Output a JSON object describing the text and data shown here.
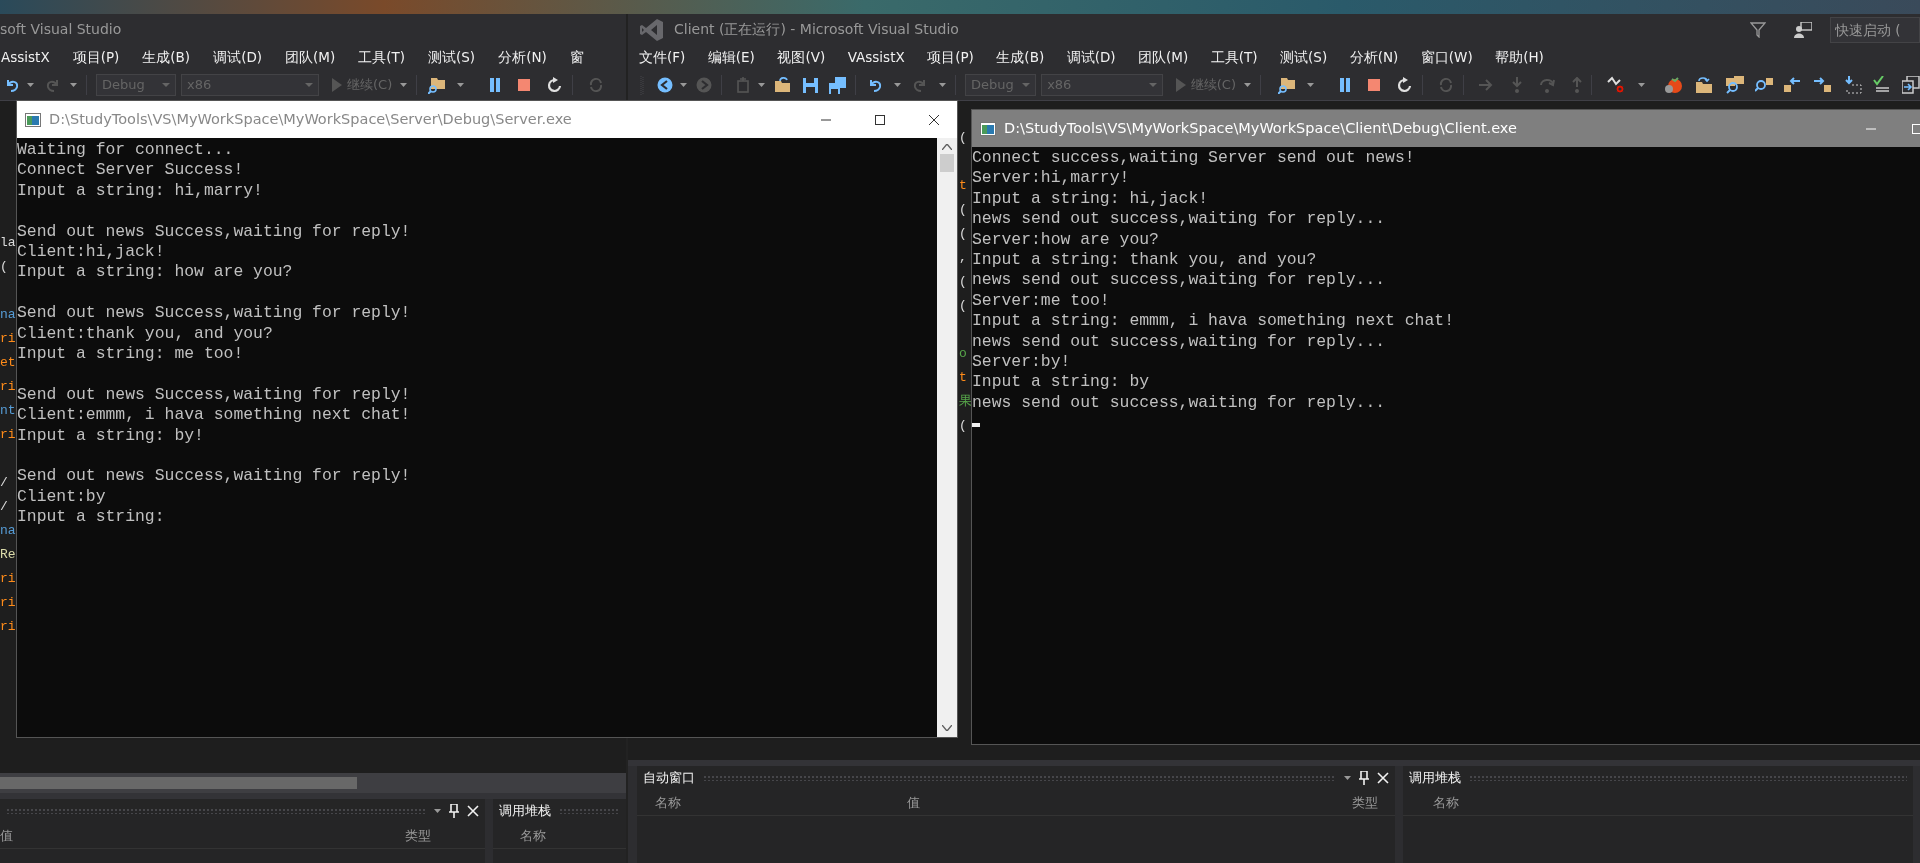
{
  "server_vs": {
    "title": "soft Visual Studio",
    "menu": [
      "AssistX",
      "项目(P)",
      "生成(B)",
      "调试(D)",
      "团队(M)",
      "工具(T)",
      "测试(S)",
      "分析(N)",
      "窗"
    ],
    "toolbar": {
      "config": {
        "value": "Debug",
        "disabled": true
      },
      "platform": {
        "value": "x86",
        "disabled": true
      },
      "continue": {
        "label": "继续(C)",
        "disabled": true
      }
    },
    "code_blocks": [
      [
        {
          "text": "la",
          "color": "#dcdcdc"
        },
        {
          "text": "("
        }
      ],
      [
        {
          "text": "na",
          "color": "#569cd6"
        },
        {
          "text": "ri",
          "color": "#ff8c1a"
        },
        {
          "text": "et",
          "color": "#ff8c1a"
        },
        {
          "text": "ri",
          "color": "#ff8c1a"
        },
        {
          "text": "nt",
          "color": "#569cd6"
        },
        {
          "text": "ri",
          "color": "#ff8c1a"
        }
      ],
      [
        {
          "text": "/"
        },
        {
          "text": "/"
        },
        {
          "text": "na",
          "color": "#569cd6"
        },
        {
          "text": "Re",
          "color": "#dcdcaa"
        },
        {
          "text": "ri",
          "color": "#ff8c1a"
        },
        {
          "text": "ri",
          "color": "#ff8c1a"
        },
        {
          "text": "ri",
          "color": "#ff8c1a"
        }
      ]
    ],
    "watch_panel": {
      "columns": [
        "值",
        "类型"
      ]
    },
    "call_stack": {
      "title": "调用堆栈",
      "columns": [
        "名称"
      ]
    }
  },
  "client_vs": {
    "title": "Client (正在运行) - Microsoft Visual Studio",
    "quick_launch": {
      "placeholder": "快速启动 ("
    },
    "menu": [
      "文件(F)",
      "编辑(E)",
      "视图(V)",
      "VAssistX",
      "项目(P)",
      "生成(B)",
      "调试(D)",
      "团队(M)",
      "工具(T)",
      "测试(S)",
      "分析(N)",
      "窗口(W)",
      "帮助(H)"
    ],
    "toolbar": {
      "config": {
        "value": "Debug",
        "disabled": true
      },
      "platform": {
        "value": "x86",
        "disabled": true
      },
      "continue": {
        "label": "继续(C)",
        "disabled": true
      }
    },
    "code_blocks": [
      [
        {
          "text": "("
        }
      ],
      [
        {
          "text": "t",
          "color": "#ff8c1a"
        },
        {
          "text": "("
        },
        {
          "text": "("
        },
        {
          "text": ","
        },
        {
          "text": "("
        },
        {
          "text": "("
        }
      ],
      [
        {
          "text": "o",
          "color": "#57a64a"
        },
        {
          "text": "t",
          "color": "#ff8c1a"
        },
        {
          "text": "果",
          "color": "#57a64a"
        },
        {
          "text": "("
        }
      ]
    ],
    "autos_panel": {
      "title": "自动窗口",
      "columns": [
        "名称",
        "值",
        "类型"
      ]
    },
    "call_stack": {
      "title": "调用堆栈",
      "columns": [
        "名称"
      ]
    }
  },
  "server_console": {
    "title": "D:\\StudyTools\\VS\\MyWorkSpace\\MyWorkSpace\\Server\\Debug\\Server.exe",
    "active": false,
    "cursor": false,
    "blocks": [
      [
        "Waiting for connect...",
        "Connect Server Success!",
        "Input a string: hi,marry!"
      ],
      [
        "Send out news Success,waiting for reply!",
        "Client:hi,jack!",
        "Input a string: how are you?"
      ],
      [
        "Send out news Success,waiting for reply!",
        "Client:thank you, and you?",
        "Input a string: me too!"
      ],
      [
        "Send out news Success,waiting for reply!",
        "Client:emmm, i hava something next chat!",
        "Input a string: by!"
      ],
      [
        "Send out news Success,waiting for reply!",
        "Client:by",
        "Input a string:"
      ]
    ]
  },
  "client_console": {
    "title": "D:\\StudyTools\\VS\\MyWorkSpace\\MyWorkSpace\\Client\\Debug\\Client.exe",
    "active": true,
    "cursor": true,
    "blocks": [
      [
        "Connect success,waiting Server send out news!",
        "Server:hi,marry!",
        "Input a string: hi,jack!",
        "news send out success,waiting for reply...",
        "Server:how are you?",
        "Input a string: thank you, and you?",
        "news send out success,waiting for reply...",
        "Server:me too!",
        "Input a string: emmm, i hava something next chat!",
        "news send out success,waiting for reply...",
        "Server:by!",
        "Input a string: by",
        "news send out success,waiting for reply..."
      ]
    ]
  }
}
